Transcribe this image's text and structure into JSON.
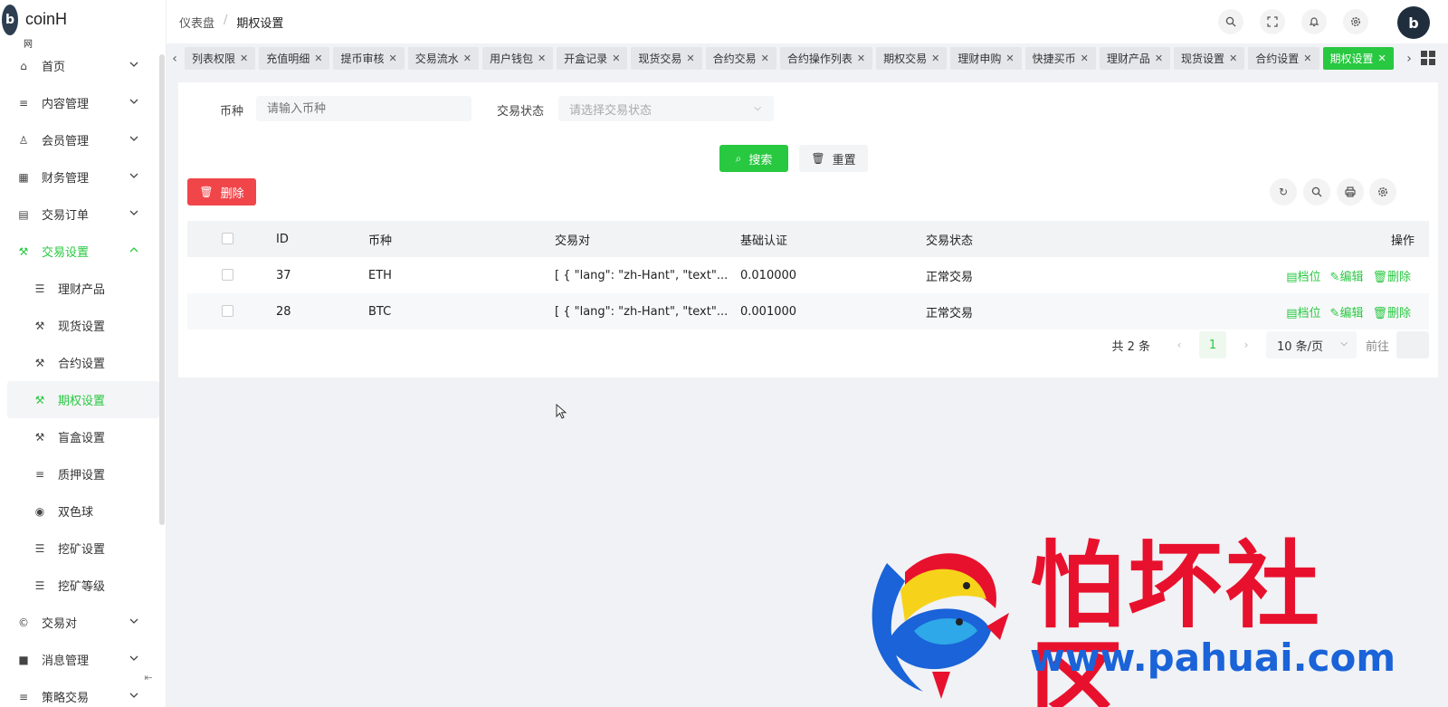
{
  "app": {
    "title": "coinH",
    "subtitle": "网",
    "logo_letter": "b"
  },
  "sidebar": {
    "items": [
      {
        "label": "首页",
        "icon": "home-icon",
        "glyph": "⌂",
        "has_children": true
      },
      {
        "label": "内容管理",
        "icon": "list-icon",
        "glyph": "≡",
        "has_children": true
      },
      {
        "label": "会员管理",
        "icon": "user-icon",
        "glyph": "♙",
        "has_children": true
      },
      {
        "label": "财务管理",
        "icon": "table-icon",
        "glyph": "▦",
        "has_children": true
      },
      {
        "label": "交易订单",
        "icon": "order-icon",
        "glyph": "▤",
        "has_children": true
      },
      {
        "label": "交易设置",
        "icon": "wrench-icon",
        "glyph": "⚒",
        "has_children": true,
        "expanded": true
      },
      {
        "label": "理财产品",
        "icon": "lines-icon",
        "glyph": "☰",
        "sub": true
      },
      {
        "label": "现货设置",
        "icon": "wrench-icon",
        "glyph": "⚒",
        "sub": true
      },
      {
        "label": "合约设置",
        "icon": "wrench-icon",
        "glyph": "⚒",
        "sub": true
      },
      {
        "label": "期权设置",
        "icon": "wrench-icon",
        "glyph": "⚒",
        "sub": true,
        "current": true
      },
      {
        "label": "盲盒设置",
        "icon": "wrench-icon",
        "glyph": "⚒",
        "sub": true
      },
      {
        "label": "质押设置",
        "icon": "list-icon",
        "glyph": "≡",
        "sub": true
      },
      {
        "label": "双色球",
        "icon": "radio-icon",
        "glyph": "◉",
        "sub": true
      },
      {
        "label": "挖矿设置",
        "icon": "lines-icon",
        "glyph": "☰",
        "sub": true
      },
      {
        "label": "挖矿等级",
        "icon": "lines-icon",
        "glyph": "☰",
        "sub": true
      },
      {
        "label": "交易对",
        "icon": "copyright-icon",
        "glyph": "©",
        "has_children": true
      },
      {
        "label": "消息管理",
        "icon": "message-icon",
        "glyph": "■",
        "has_children": true
      },
      {
        "label": "策略交易",
        "icon": "lines-icon",
        "glyph": "≡",
        "has_children": true
      }
    ]
  },
  "header": {
    "breadcrumb": [
      "仪表盘",
      "期权设置"
    ]
  },
  "tabs": [
    {
      "label": "列表权限"
    },
    {
      "label": "充值明细"
    },
    {
      "label": "提币审核"
    },
    {
      "label": "交易流水"
    },
    {
      "label": "用户钱包"
    },
    {
      "label": "开盒记录"
    },
    {
      "label": "现货交易"
    },
    {
      "label": "合约交易"
    },
    {
      "label": "合约操作列表"
    },
    {
      "label": "期权交易"
    },
    {
      "label": "理财申购"
    },
    {
      "label": "快捷买币"
    },
    {
      "label": "理财产品"
    },
    {
      "label": "现货设置"
    },
    {
      "label": "合约设置"
    },
    {
      "label": "期权设置",
      "active": true
    }
  ],
  "filters": {
    "coin_label": "币种",
    "coin_placeholder": "请输入币种",
    "status_label": "交易状态",
    "status_placeholder": "请选择交易状态",
    "search_label": "搜索",
    "reset_label": "重置"
  },
  "toolbar": {
    "delete_label": "删除"
  },
  "table": {
    "headers": {
      "id": "ID",
      "coin": "币种",
      "pair": "交易对",
      "base": "基础认证",
      "status": "交易状态",
      "ops": "操作"
    },
    "rows": [
      {
        "id": "37",
        "coin": "ETH",
        "pair": "[ { \"lang\": \"zh-Hant\", \"text\"...",
        "base": "0.010000",
        "status": "正常交易"
      },
      {
        "id": "28",
        "coin": "BTC",
        "pair": "[ { \"lang\": \"zh-Hant\", \"text\"...",
        "base": "0.001000",
        "status": "正常交易"
      }
    ],
    "ops": {
      "level": "档位",
      "edit": "编辑",
      "delete": "删除"
    }
  },
  "pagination": {
    "total": "共 2 条",
    "current_page": "1",
    "page_size": "10 条/页",
    "goto": "前往"
  },
  "watermark": {
    "text": "怕坏社区",
    "url": "www.pahuai.com"
  },
  "colors": {
    "accent": "#28c840",
    "danger": "#f0464a",
    "watermark_red": "#e8112d",
    "watermark_blue": "#1a63d8"
  }
}
